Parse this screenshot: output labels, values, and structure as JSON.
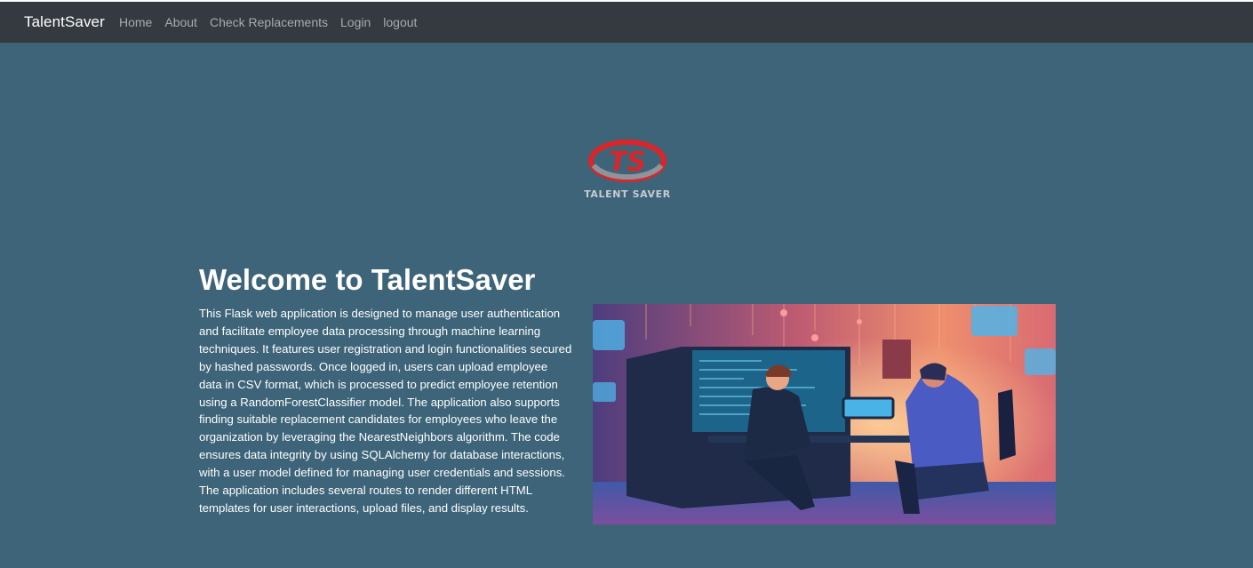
{
  "navbar": {
    "brand": "TalentSaver",
    "links": [
      "Home",
      "About",
      "Check Replacements",
      "Login",
      "logout"
    ]
  },
  "logo": {
    "monogram": "TS",
    "text": "TALENT SAVER"
  },
  "main": {
    "title": "Welcome to TalentSaver",
    "description": "This Flask web application is designed to manage user authentication and facilitate employee data processing through machine learning techniques. It features user registration and login functionalities secured by hashed passwords. Once logged in, users can upload employee data in CSV format, which is processed to predict employee retention using a RandomForestClassifier model. The application also supports finding suitable replacement candidates for employees who leave the organization by leveraging the NearestNeighbors algorithm. The code ensures data integrity by using SQLAlchemy for database interactions, with a user model defined for managing user credentials and sessions. The application includes several routes to render different HTML templates for user interactions, upload files, and display results."
  },
  "colors": {
    "navbar_bg": "#343a40",
    "page_bg": "#3d6478",
    "logo_red": "#d9262b",
    "logo_gray": "#8e9499"
  }
}
